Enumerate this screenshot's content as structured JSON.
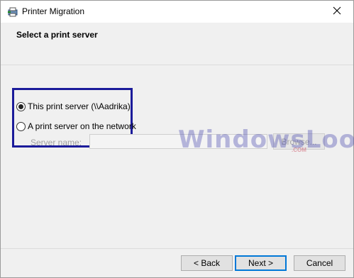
{
  "window": {
    "title": "Printer Migration"
  },
  "header": {
    "title": "Select a print server"
  },
  "options": {
    "local": {
      "label": "This print server (\\\\Aadrika)",
      "selected": true
    },
    "network": {
      "label": "A print server on the network",
      "selected": false
    }
  },
  "server_field": {
    "label": "Server name:",
    "value": ""
  },
  "browse": {
    "label": "Browse..."
  },
  "watermark": {
    "text": "WindowsLoop",
    "sub": ".COM"
  },
  "buttons": {
    "back": "< Back",
    "next": "Next >",
    "cancel": "Cancel"
  },
  "colors": {
    "highlight": "#1b1b9a",
    "focus": "#0078d7"
  }
}
